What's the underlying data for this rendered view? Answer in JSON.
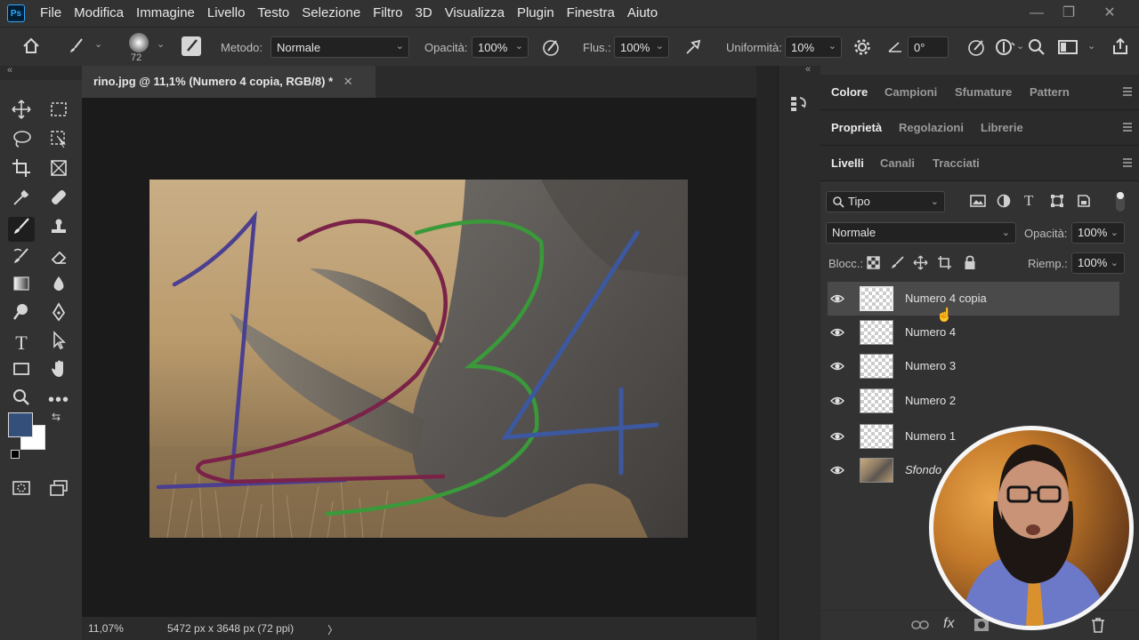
{
  "app": {
    "logo": "Ps"
  },
  "menu": [
    "File",
    "Modifica",
    "Immagine",
    "Livello",
    "Testo",
    "Selezione",
    "Filtro",
    "3D",
    "Visualizza",
    "Plugin",
    "Finestra",
    "Aiuto"
  ],
  "window_controls": {
    "minimize": "—",
    "restore": "❐",
    "close": "✕"
  },
  "options": {
    "brush_size": "72",
    "metodo_label": "Metodo:",
    "metodo_value": "Normale",
    "opacita_label": "Opacità:",
    "opacita_value": "100%",
    "flusso_label": "Flus.:",
    "flusso_value": "100%",
    "uniformita_label": "Uniformità:",
    "uniformita_value": "10%",
    "angle_value": "0°"
  },
  "document": {
    "tab_title": "rino.jpg @ 11,1% (Numero 4 copia, RGB/8) *",
    "tab_close": "✕",
    "zoom": "11,07%",
    "dimensions": "5472 px x 3648 px (72 ppi)",
    "status_arrow": "〉"
  },
  "colors": {
    "foreground": "#34507a",
    "background": "#ffffff",
    "canvas_bg": "#1b1b1b",
    "panel_bg": "#323232"
  },
  "panel_group1": {
    "tabs": [
      "Colore",
      "Campioni",
      "Sfumature",
      "Pattern"
    ],
    "active": "Colore"
  },
  "panel_group2": {
    "tabs": [
      "Proprietà",
      "Regolazioni",
      "Librerie"
    ],
    "active": "Proprietà"
  },
  "layers_panel": {
    "tabs": [
      "Livelli",
      "Canali",
      "Tracciati"
    ],
    "active": "Livelli",
    "filter_label": "Tipo",
    "blend_mode": "Normale",
    "opacity_label": "Opacità:",
    "opacity_value": "100%",
    "lock_label": "Blocc.:",
    "fill_label": "Riemp.:",
    "fill_value": "100%",
    "layers": [
      {
        "name": "Numero 4 copia",
        "selected": true
      },
      {
        "name": "Numero 4",
        "selected": false
      },
      {
        "name": "Numero 3",
        "selected": false
      },
      {
        "name": "Numero 2",
        "selected": false
      },
      {
        "name": "Numero 1",
        "selected": false
      },
      {
        "name": "Sfondo",
        "selected": false
      }
    ],
    "footer_fx": "fx"
  }
}
